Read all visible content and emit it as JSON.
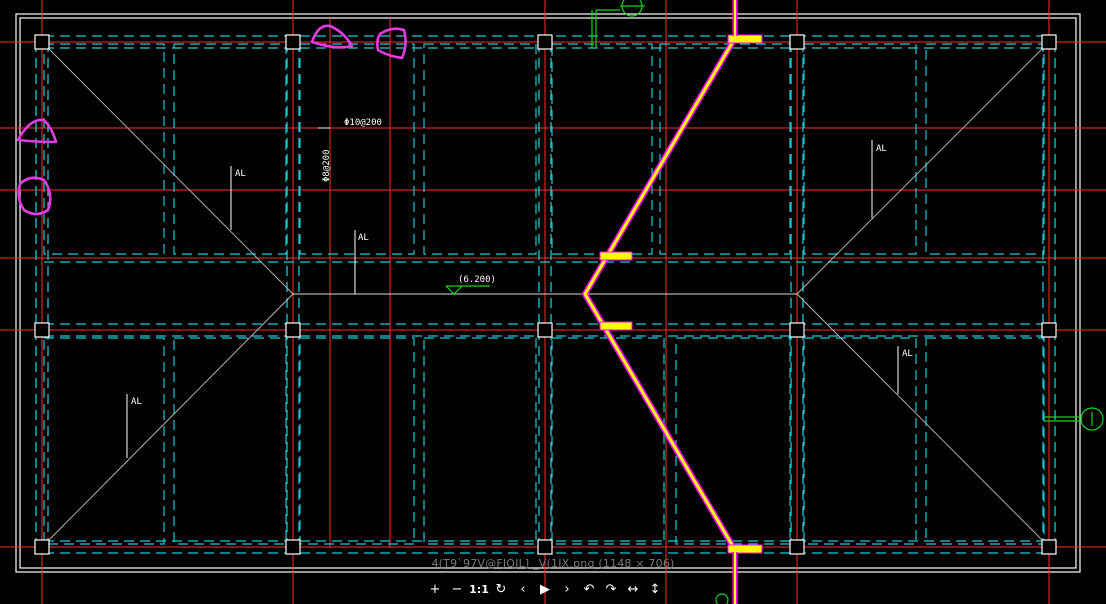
{
  "viewer": {
    "caption": "4(T9`97V@FJQJL] _V(1IX.png (1148 × 706)",
    "toolbar": [
      {
        "name": "zoom-in-button",
        "icon": "plus-icon",
        "label": "+"
      },
      {
        "name": "zoom-out-button",
        "icon": "minus-icon",
        "label": "−"
      },
      {
        "name": "actual-size-button",
        "icon": "one-to-one-icon",
        "label": "1:1"
      },
      {
        "name": "reset-button",
        "icon": "refresh-icon",
        "label": "↻"
      },
      {
        "name": "previous-button",
        "icon": "chevron-left-icon",
        "label": "‹"
      },
      {
        "name": "slideshow-button",
        "icon": "play-icon",
        "label": "▶"
      },
      {
        "name": "next-button",
        "icon": "chevron-right-icon",
        "label": "›"
      },
      {
        "name": "rotate-left-button",
        "icon": "rotate-left-icon",
        "label": "↶"
      },
      {
        "name": "rotate-right-button",
        "icon": "rotate-right-icon",
        "label": "↷"
      },
      {
        "name": "flip-horizontal-button",
        "icon": "flip-horizontal-icon",
        "label": "↔"
      },
      {
        "name": "flip-vertical-button",
        "icon": "flip-vertical-icon",
        "label": "↕"
      }
    ]
  },
  "drawing": {
    "annotations": [
      {
        "id": "rebar-top",
        "text": "Φ10@200"
      },
      {
        "id": "rebar-vertical",
        "text": "Φ8@200"
      },
      {
        "id": "al-1",
        "text": "AL"
      },
      {
        "id": "al-2",
        "text": "AL"
      },
      {
        "id": "al-3",
        "text": "AL"
      },
      {
        "id": "al-4",
        "text": "AL"
      },
      {
        "id": "al-5",
        "text": "AL"
      },
      {
        "id": "elevation",
        "text": "(6.200)"
      }
    ],
    "colors": {
      "background": "#000000",
      "frame": "#ffffff",
      "axis": "#ff2a2a",
      "beam-dashed": "#19c9d6",
      "column": "#ffffff",
      "slab-diagonal": "#bdbdbd",
      "break-line": "#ffff00",
      "break-line-edge": "#ff00ff",
      "markup": "#e33ae3",
      "grid-bubble": "#19d21a"
    }
  }
}
